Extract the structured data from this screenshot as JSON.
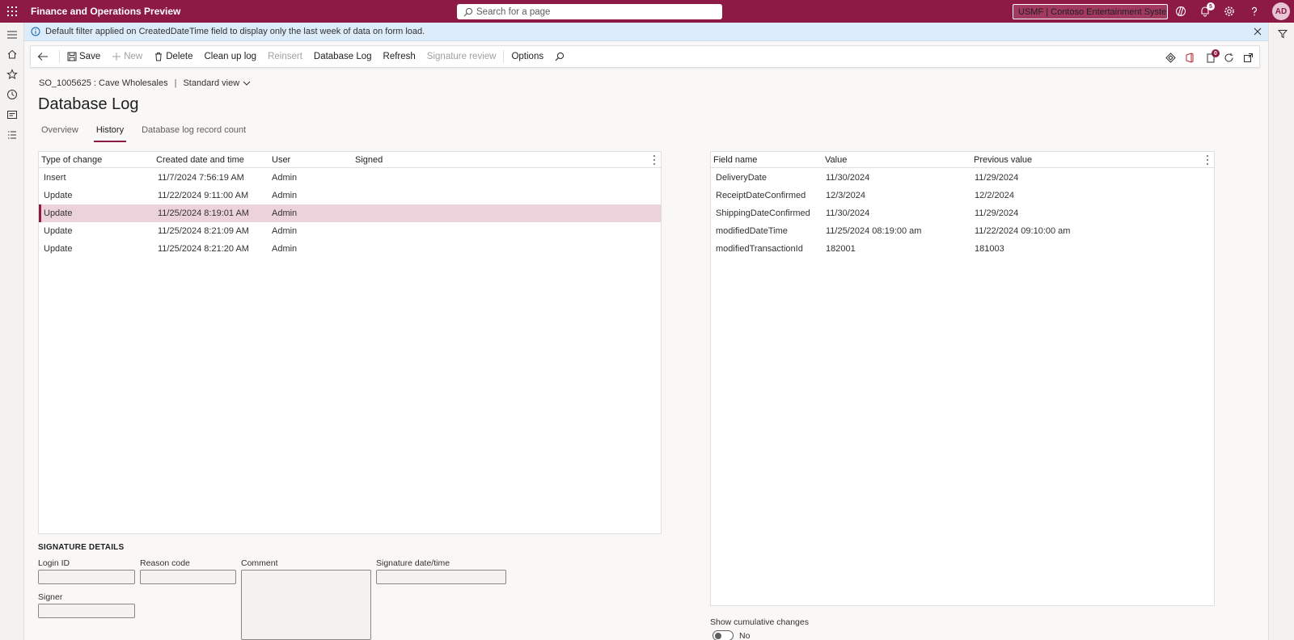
{
  "app": {
    "title": "Finance and Operations Preview",
    "search_placeholder": "Search for a page",
    "company": "USMF | Contoso Entertainment Syste...",
    "avatar": "AD",
    "notification_count": "5"
  },
  "banner": {
    "message": "Default filter applied on CreatedDateTime field to display only the last week of data on form load."
  },
  "actions": {
    "save": "Save",
    "new": "New",
    "delete": "Delete",
    "cleanup": "Clean up log",
    "reinsert": "Reinsert",
    "database_log": "Database Log",
    "refresh": "Refresh",
    "signature_review": "Signature review",
    "options": "Options",
    "attachments_count": "0"
  },
  "header": {
    "record": "SO_1005625 : Cave Wholesales",
    "view": "Standard view",
    "title": "Database Log"
  },
  "tabs": [
    {
      "label": "Overview"
    },
    {
      "label": "History"
    },
    {
      "label": "Database log record count"
    }
  ],
  "history_grid": {
    "columns": [
      "Type of change",
      "Created date and time",
      "User",
      "Signed"
    ],
    "rows": [
      {
        "type": "Insert",
        "created": "11/7/2024 7:56:19 AM",
        "user": "Admin",
        "signed": ""
      },
      {
        "type": "Update",
        "created": "11/22/2024 9:11:00 AM",
        "user": "Admin",
        "signed": ""
      },
      {
        "type": "Update",
        "created": "11/25/2024 8:19:01 AM",
        "user": "Admin",
        "signed": ""
      },
      {
        "type": "Update",
        "created": "11/25/2024 8:21:09 AM",
        "user": "Admin",
        "signed": ""
      },
      {
        "type": "Update",
        "created": "11/25/2024 8:21:20 AM",
        "user": "Admin",
        "signed": ""
      }
    ]
  },
  "changes_grid": {
    "columns": [
      "Field name",
      "Value",
      "Previous value"
    ],
    "rows": [
      {
        "field": "DeliveryDate",
        "value": "11/30/2024",
        "previous": "11/29/2024"
      },
      {
        "field": "ReceiptDateConfirmed",
        "value": "12/3/2024",
        "previous": "12/2/2024"
      },
      {
        "field": "ShippingDateConfirmed",
        "value": "11/30/2024",
        "previous": "11/29/2024"
      },
      {
        "field": "modifiedDateTime",
        "value": "11/25/2024 08:19:00 am",
        "previous": "11/22/2024 09:10:00 am"
      },
      {
        "field": "modifiedTransactionId",
        "value": "182001",
        "previous": "181003"
      }
    ]
  },
  "signature": {
    "title": "SIGNATURE DETAILS",
    "login_id": "Login ID",
    "reason_code": "Reason code",
    "comment": "Comment",
    "signature_datetime": "Signature date/time",
    "signer": "Signer"
  },
  "cumulative": {
    "label": "Show cumulative changes",
    "value": "No"
  },
  "colors": {
    "brand": "#8c1a44",
    "selected_row": "#ecd2db",
    "banner": "#dcecfb"
  }
}
